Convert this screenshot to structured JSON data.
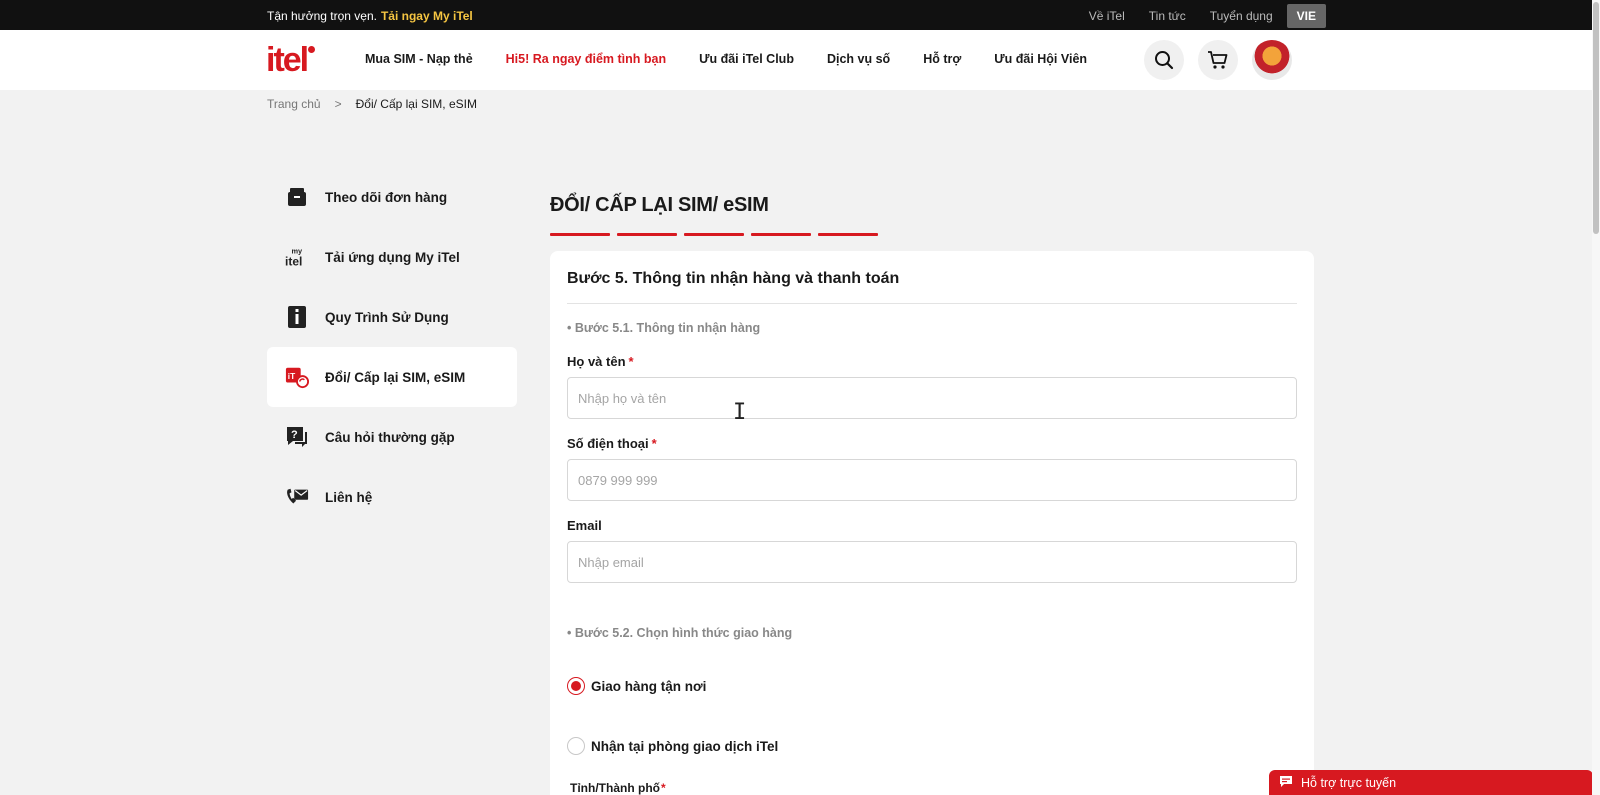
{
  "topbar": {
    "promo_text": "Tận hưởng trọn vẹn.",
    "promo_link": "Tải ngay My iTel",
    "links": [
      "Về iTel",
      "Tin tức",
      "Tuyển dụng"
    ],
    "lang": "VIE"
  },
  "header": {
    "logo": "itel",
    "nav": [
      "Mua SIM - Nạp thẻ",
      "Hi5! Ra ngay điểm tình bạn",
      "Ưu đãi iTel Club",
      "Dịch vụ số",
      "Hỗ trợ",
      "Ưu đãi Hội Viên"
    ]
  },
  "breadcrumb": {
    "home": "Trang chủ",
    "separator": ">",
    "current": "Đổi/ Cấp lại SIM, eSIM"
  },
  "sidebar": {
    "items": [
      {
        "label": "Theo dõi đơn hàng",
        "icon": "box-icon"
      },
      {
        "label": "Tải ứng dụng My iTel",
        "icon": "myitel-icon"
      },
      {
        "label": "Quy Trình Sử Dụng",
        "icon": "info-book-icon"
      },
      {
        "label": "Đổi/ Cấp lại SIM, eSIM",
        "icon": "sim-swap-icon",
        "active": true
      },
      {
        "label": "Câu hỏi thường gặp",
        "icon": "question-chat-icon"
      },
      {
        "label": "Liên hệ",
        "icon": "phone-mail-icon"
      }
    ]
  },
  "main": {
    "title": "ĐỔI/ CẤP LẠI SIM/ eSIM",
    "step_count": 5,
    "card_title": "Bước 5. Thông tin nhận hàng và thanh toán",
    "section1": "• Bước 5.1. Thông tin nhận hàng",
    "fields": {
      "name_label": "Họ và tên",
      "name_placeholder": "Nhập họ và tên",
      "phone_label": "Số điện thoại",
      "phone_placeholder": "0879 999 999",
      "email_label": "Email",
      "email_placeholder": "Nhập email",
      "required_mark": "*"
    },
    "section2": "• Bước 5.2. Chọn hình thức giao hàng",
    "delivery_options": [
      "Giao hàng tận nơi",
      "Nhận tại phòng giao dịch iTel"
    ],
    "city_label": "Tỉnh/Thành phố"
  },
  "chat": {
    "label": "Hỗ trợ trực tuyến"
  },
  "colors": {
    "brand": "#d71920",
    "promo": "#f5c542"
  }
}
